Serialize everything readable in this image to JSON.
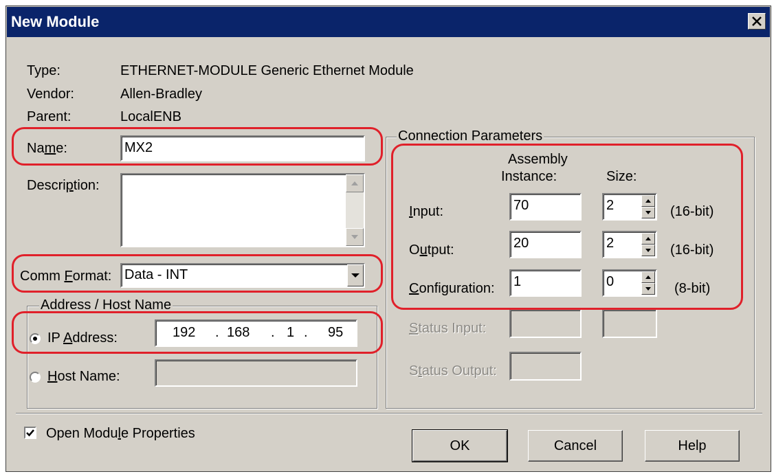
{
  "window": {
    "title": "New Module"
  },
  "info": {
    "type_label": "Type:",
    "type_value": "ETHERNET-MODULE Generic Ethernet Module",
    "vendor_label": "Vendor:",
    "vendor_value": "Allen-Bradley",
    "parent_label": "Parent:",
    "parent_value": "LocalENB"
  },
  "name": {
    "label_pre": "Na",
    "label_ul": "m",
    "label_post": "e:",
    "value": "MX2"
  },
  "description": {
    "label_pre": "Descri",
    "label_ul": "p",
    "label_post": "tion:",
    "value": ""
  },
  "comm_format": {
    "label_pre": "Comm ",
    "label_ul": "F",
    "label_post": "ormat:",
    "value": "Data - INT"
  },
  "address": {
    "group_label": "Address / Host Name",
    "ip_label_pre": "IP ",
    "ip_label_ul": "A",
    "ip_label_post": "ddress:",
    "ip_octets": [
      "192",
      "168",
      "1",
      "95"
    ],
    "ip_selected": true,
    "host_label_pre": "",
    "host_label_ul": "H",
    "host_label_post": "ost Name:",
    "host_value": ""
  },
  "connection": {
    "group_label": "Connection Parameters",
    "col_assembly_line1": "Assembly",
    "col_assembly_line2": "Instance:",
    "col_size": "Size:",
    "rows": [
      {
        "label_pre": "",
        "label_ul": "I",
        "label_post": "nput:",
        "instance": "70",
        "size": "2",
        "unit": "(16-bit)"
      },
      {
        "label_pre": "O",
        "label_ul": "u",
        "label_post": "tput:",
        "instance": "20",
        "size": "2",
        "unit": "(16-bit)"
      },
      {
        "label_pre": "",
        "label_ul": "C",
        "label_post": "onfiguration:",
        "instance": "1",
        "size": "0",
        "unit": "(8-bit)"
      }
    ],
    "status_input_label_pre": "",
    "status_input_label_ul": "S",
    "status_input_label_post": "tatus Input:",
    "status_output_label_pre": "S",
    "status_output_label_ul": "t",
    "status_output_label_post": "atus Output:"
  },
  "open_props": {
    "label_pre": "Open Modu",
    "label_ul": "l",
    "label_post": "e Properties",
    "checked": true
  },
  "buttons": {
    "ok": "OK",
    "cancel": "Cancel",
    "help": "Help"
  },
  "colors": {
    "titlebar": "#0a246a",
    "face": "#d4d0c8",
    "highlight_outline": "#e0202a"
  }
}
